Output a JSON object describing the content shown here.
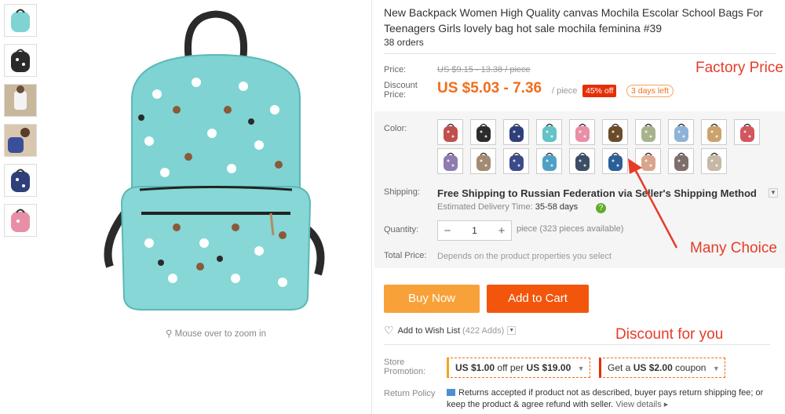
{
  "product": {
    "title": "New Backpack Women High Quality canvas Mochila Escolar School Bags For Teenagers Girls lovely bag hot sale mochila feminina #39",
    "orders": "38 orders"
  },
  "gallery": {
    "zoom_hint": "Mouse over to zoom in",
    "thumbnails": [
      "mint",
      "black",
      "photo",
      "photo",
      "navy",
      "pink"
    ]
  },
  "price": {
    "price_label": "Price:",
    "old_price": "US $9.15 - 13.38 / piece",
    "discount_label_1": "Discount",
    "discount_label_2": "Price:",
    "discount_price": "US $5.03 - 7.36",
    "per_piece": "/ piece",
    "off_badge": "45% off",
    "days_left": "3 days left"
  },
  "annotations": {
    "factory_price": "Factory Price",
    "many_choice": "Many Choice",
    "discount_for_you": "Discount for you"
  },
  "sku": {
    "color_label": "Color:",
    "swatches": [
      "#c0504d",
      "#2b2b2b",
      "#2e3f7a",
      "#63c3c6",
      "#e88fa6",
      "#6b4c2a",
      "#a7b38d",
      "#8db3d6",
      "#c9a36b",
      "#d3565e",
      "#8f7bb0",
      "#a48a72",
      "#3a4a8a",
      "#4fa0c6",
      "#3c4d66",
      "#2c5f99",
      "#d9a58c",
      "#7d6e6a",
      "#c5b8a5"
    ],
    "shipping_label": "Shipping:",
    "shipping_text": "Free Shipping to Russian Federation via Seller's Shipping Method",
    "delivery_label": "Estimated Delivery Time:",
    "delivery_value": "35-58 days",
    "quantity_label": "Quantity:",
    "quantity_minus": "−",
    "quantity_value": "1",
    "quantity_plus": "+",
    "pieces_available": "piece (323 pieces available)",
    "total_label": "Total Price:",
    "total_value": "Depends on the product properties you select"
  },
  "actions": {
    "buy_now": "Buy Now",
    "add_to_cart": "Add to Cart",
    "wish_label": "Add to Wish List",
    "wish_count": "(422 Adds)"
  },
  "promotion": {
    "store_label_1": "Store",
    "store_label_2": "Promotion:",
    "coupon1_prefix": "US $1.00",
    "coupon1_mid": "off per",
    "coupon1_suffix": "US $19.00",
    "coupon2_prefix": "Get a",
    "coupon2_value": "US $2.00",
    "coupon2_suffix": "coupon",
    "return_label": "Return Policy",
    "return_text": "Returns accepted if product not as described, buyer pays return shipping fee; or keep the product & agree refund with seller.",
    "view_details": "View details ▸"
  },
  "colors": {
    "accent_orange": "#f26c1a",
    "buy_now_bg": "#f7a138",
    "cart_bg": "#f2560c",
    "annotation_red": "#e53c29",
    "bag_mint": "#7fd3d3"
  }
}
